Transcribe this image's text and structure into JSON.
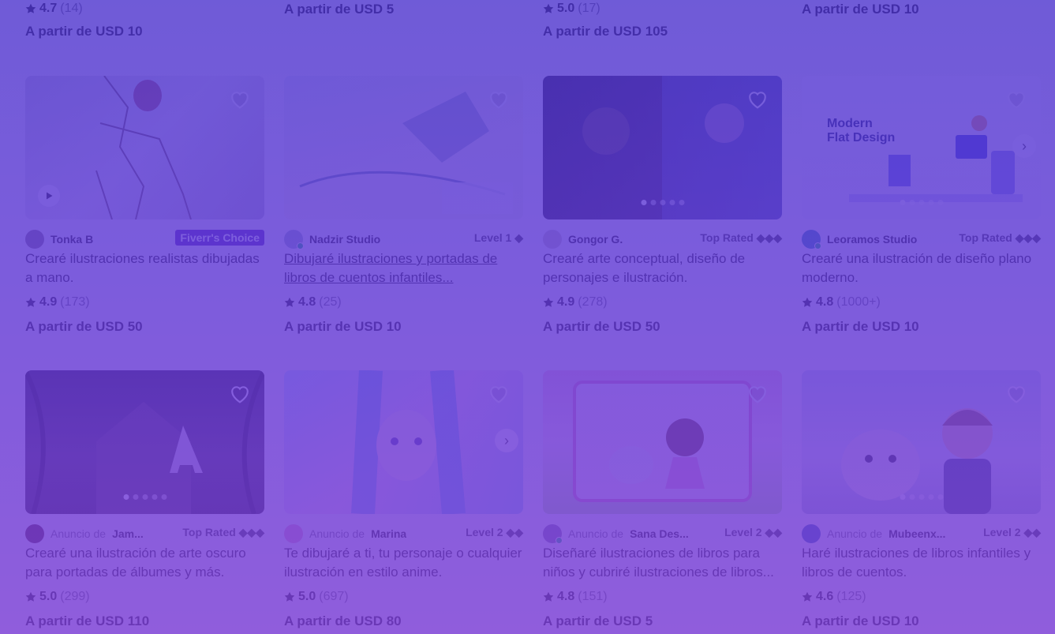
{
  "top_row": [
    {
      "score": "4.7",
      "count": "(14)",
      "price": "A partir de USD 10"
    },
    {
      "price": "A partir de USD 5"
    },
    {
      "score": "5.0",
      "count": "(17)",
      "price": "A partir de USD 105"
    },
    {
      "price": "A partir de USD 10"
    }
  ],
  "cards": [
    {
      "seller": "Tonka B",
      "badge": "Fiverr's Choice",
      "title": "Crearé ilustraciones realistas dibujadas a mano.",
      "score": "4.9",
      "count": "(173)",
      "price": "A partir de USD 50"
    },
    {
      "seller": "Nadzir Studio",
      "badge": "Level 1 ◆",
      "title": "Dibujaré ilustraciones y portadas de libros de cuentos infantiles...",
      "score": "4.8",
      "count": "(25)",
      "price": "A partir de USD 10"
    },
    {
      "seller": "Gongor G.",
      "badge": "Top Rated ◆◆◆",
      "title": "Crearé arte conceptual, diseño de personajes e ilustración.",
      "score": "4.9",
      "count": "(278)",
      "price": "A partir de USD 50"
    },
    {
      "seller": "Leoramos Studio",
      "badge": "Top Rated ◆◆◆",
      "title": "Crearé una ilustración de diseño plano moderno.",
      "score": "4.8",
      "count": "(1000+)",
      "price": "A partir de USD 10",
      "thumb_text_1": "Modern",
      "thumb_text_2": "Flat Design"
    },
    {
      "ad_label": "Anuncio de",
      "seller": "Jam...",
      "badge": "Top Rated ◆◆◆",
      "title": "Crearé una ilustración de arte oscuro para portadas de álbumes y más.",
      "score": "5.0",
      "count": "(299)",
      "price": "A partir de USD 110"
    },
    {
      "ad_label": "Anuncio de",
      "seller": "Marina",
      "badge": "Level 2 ◆◆",
      "title": "Te dibujaré a ti, tu personaje o cualquier ilustración en estilo anime.",
      "score": "5.0",
      "count": "(697)",
      "price": "A partir de USD 80"
    },
    {
      "ad_label": "Anuncio de",
      "seller": "Sana Des...",
      "badge": "Level 2 ◆◆",
      "title": "Diseñaré ilustraciones de libros para niños y cubriré ilustraciones de libros...",
      "score": "4.8",
      "count": "(151)",
      "price": "A partir de USD 5"
    },
    {
      "ad_label": "Anuncio de",
      "seller": "Mubeenx...",
      "badge": "Level 2 ◆◆",
      "title": "Haré ilustraciones de libros infantiles y libros de cuentos.",
      "score": "4.6",
      "count": "(125)",
      "price": "A partir de USD 10"
    }
  ],
  "icons": {
    "favorite": "heart-outline-icon",
    "rating": "star-icon",
    "play": "play-icon",
    "next": "chevron-right-icon"
  },
  "colors": {
    "overlay": "#5a36d2",
    "badge_choice": "#5f2fb5",
    "online": "#1dbf73"
  }
}
